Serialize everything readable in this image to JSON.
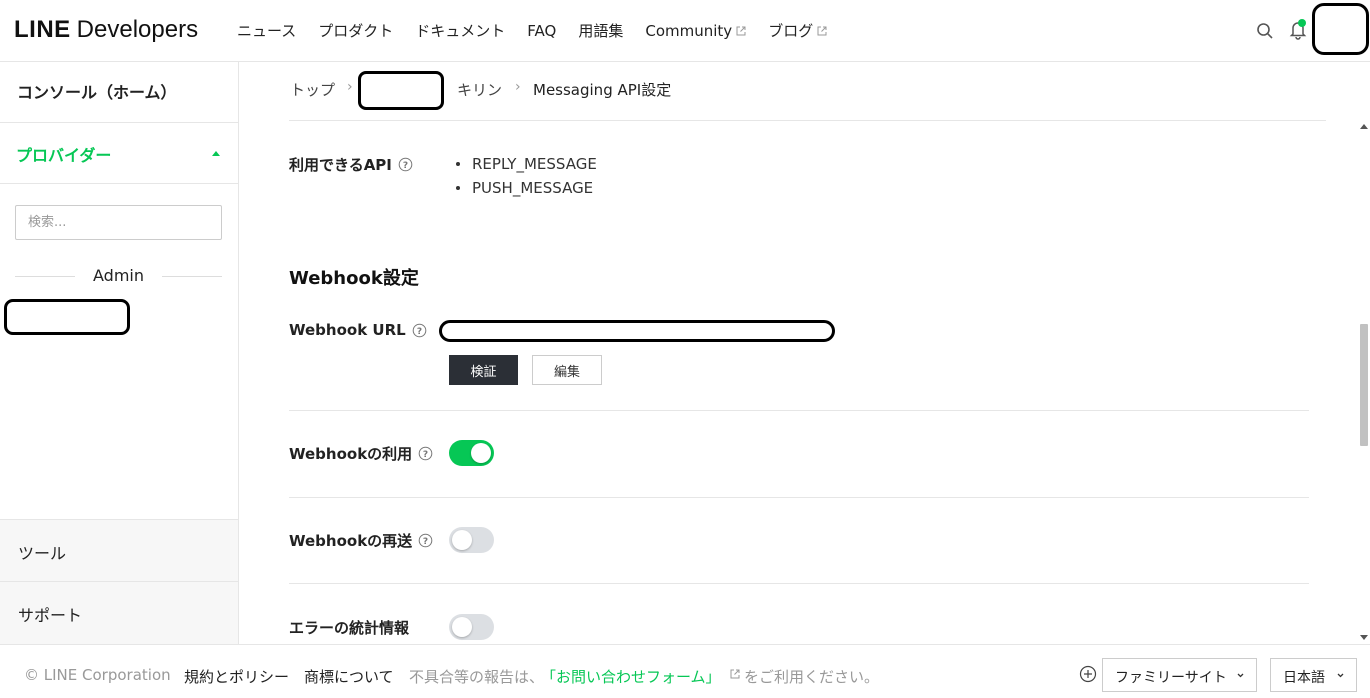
{
  "header": {
    "logo_bold": "LINE",
    "logo_text": "Developers",
    "nav": [
      "ニュース",
      "プロダクト",
      "ドキュメント",
      "FAQ",
      "用語集",
      "Community",
      "ブログ"
    ]
  },
  "sidebar": {
    "home": "コンソール（ホーム）",
    "provider": "プロバイダー",
    "search_placeholder": "検索...",
    "admin_label": "Admin",
    "tools": "ツール",
    "support": "サポート"
  },
  "breadcrumb": {
    "top": "トップ",
    "channel": "キリン",
    "current": "Messaging API設定"
  },
  "api": {
    "label": "利用できるAPI",
    "items": [
      "REPLY_MESSAGE",
      "PUSH_MESSAGE"
    ]
  },
  "webhook": {
    "section_title": "Webhook設定",
    "url_label": "Webhook URL",
    "verify_button": "検証",
    "edit_button": "編集",
    "use_label": "Webhookの利用",
    "use_enabled": true,
    "redelivery_label": "Webhookの再送",
    "redelivery_enabled": false,
    "error_stats_label": "エラーの統計情報",
    "error_stats_enabled": false
  },
  "footer": {
    "copyright": "© LINE Corporation",
    "terms": "規約とポリシー",
    "trademark": "商標について",
    "report_prefix": "不具合等の報告は、",
    "report_link": "「お問い合わせフォーム」",
    "report_suffix": "をご利用ください。",
    "family_site": "ファミリーサイト",
    "language": "日本語"
  },
  "colors": {
    "brand_green": "#06c755",
    "dark_button": "#2b2f36"
  }
}
